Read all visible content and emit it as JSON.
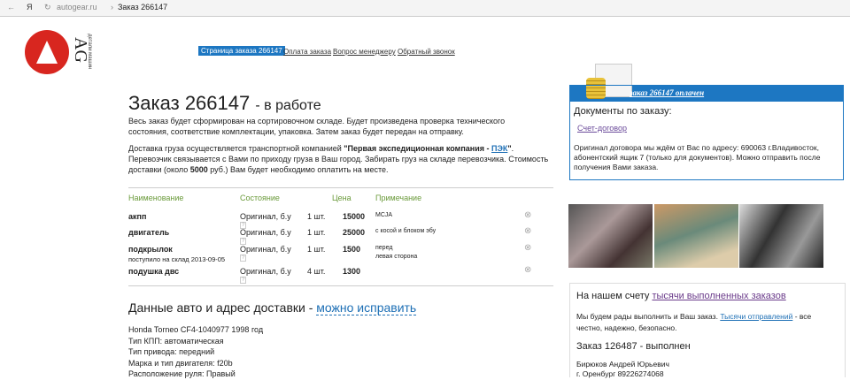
{
  "browser": {
    "domain": "autogear.ru",
    "separator": "›",
    "title": "Заказ 266147"
  },
  "logo": {
    "letters": "AG",
    "tagline": "детали машин"
  },
  "nav": [
    "Страница заказа 266147",
    "Оплата заказа",
    "Вопрос менеджеру",
    "Обратный звонок"
  ],
  "order": {
    "title": "Заказ 266147",
    "status": "- в работе",
    "desc": "Весь заказ будет сформирован на сортировочном складе. Будет произведена проверка технического состояния, соответствие комплектации, упаковка. Затем заказ будет передан на отправку.",
    "delivery_pre": "Доставка груза осуществляется транспортной компанией ",
    "carrier": "\"Первая экспедиционная компания - ",
    "carrier_link": "ПЭК",
    "carrier_end": "\"",
    "delivery_post": ". Перевозчик связывается с Вами по приходу груза в Ваш город. Забирать груз на складе перевозчика. Стоимость доставки (около ",
    "cost": "5000",
    "delivery_end": " руб.) Вам будет необходимо оплатить на месте."
  },
  "table": {
    "headers": [
      "Наименование",
      "Состояние",
      "Цена",
      "Примечание"
    ],
    "rows": [
      {
        "name": "акпп",
        "sub": "",
        "state": "Оригинал, б.у",
        "qty": "1 шт.",
        "price": "15000",
        "note": "MCJA",
        "note2": ""
      },
      {
        "name": "двигатель",
        "sub": "",
        "state": "Оригинал, б.у",
        "qty": "1 шт.",
        "price": "25000",
        "note": "с косой и блоком эбу",
        "note2": ""
      },
      {
        "name": "подкрылок",
        "sub": "поступило на склад 2013-09-05",
        "state": "Оригинал, б.у",
        "qty": "1 шт.",
        "price": "1500",
        "note": "перед",
        "note2": "левая сторона"
      },
      {
        "name": "подушка двс",
        "sub": "",
        "state": "Оригинал, б.у",
        "qty": "4 шт.",
        "price": "1300",
        "note": "",
        "note2": ""
      }
    ]
  },
  "car": {
    "heading": "Данные авто и адрес доставки - ",
    "edit": "можно исправить",
    "lines": [
      "Honda Torneo CF4-1040977 1998 год",
      "Тип КПП: автоматическая",
      "Тип привода: передний",
      "Марка и тип двигателя: f20b",
      "Расположение руля: Правый"
    ]
  },
  "paid": {
    "banner": "заказ 266147 оплачен",
    "docs_title": "Документы по заказу:",
    "doc_link": "Счет-договор",
    "text": "Оригинал договора мы ждём от Вас по адресу: 690063 г.Владивосток, абонентский ящик 7 (только для документов). Можно отправить после получения Вами заказа."
  },
  "promo": {
    "title": "На нашем счету ",
    "title_link": "тысячи выполненных заказов",
    "text_pre": "Мы будем рады выполнить и Ваш заказ. ",
    "text_link": "Тысячи отправлений",
    "text_post": " - все честно, надежно, безопасно.",
    "order": "Заказ 126487 - выполнен",
    "name": "Бирюков Андрей Юрьевич",
    "city": "г. Оренбург 89226274068"
  }
}
